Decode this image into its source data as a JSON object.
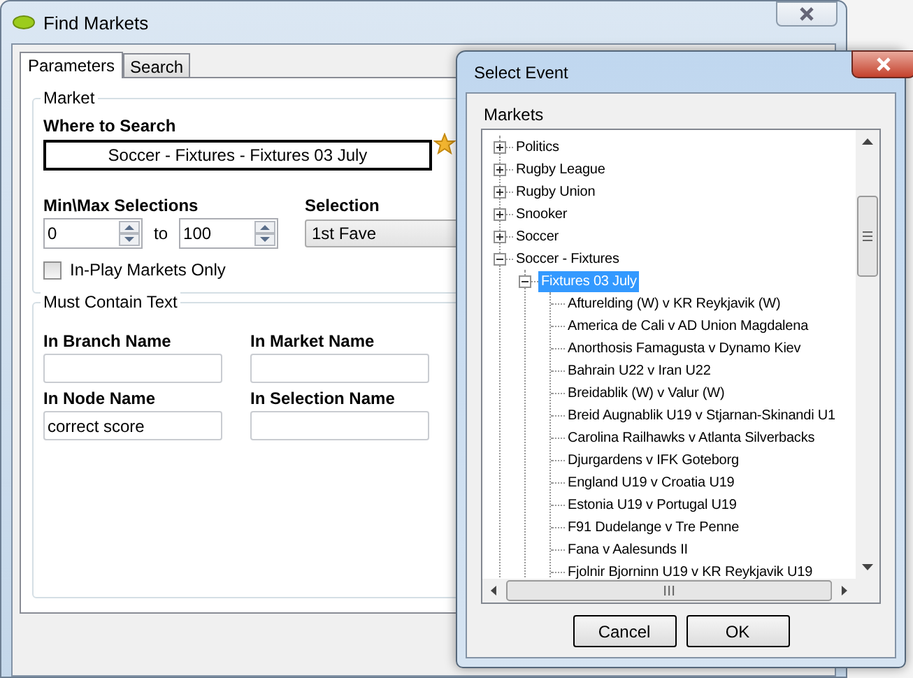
{
  "main_window": {
    "title": "Find Markets",
    "tabs": [
      {
        "label": "Parameters",
        "selected": true
      },
      {
        "label": "Search",
        "selected": false
      }
    ],
    "market_group": {
      "title": "Market",
      "where_label": "Where to Search",
      "where_value": "Soccer - Fixtures - Fixtures 03 July",
      "minmax_label": "Min\\Max Selections",
      "min_value": "0",
      "to_label": "to",
      "max_value": "100",
      "selection_label": "Selection",
      "selection_value": "1st Fave",
      "inplay": {
        "label": "In-Play Markets Only",
        "checked": false
      }
    },
    "text_group": {
      "title": "Must Contain Text",
      "fields": [
        {
          "label": "In Branch Name"
        },
        {
          "label": "In Market Name"
        },
        {
          "label": "In Node Name",
          "value": "correct score"
        },
        {
          "label": "In Selection Name"
        }
      ]
    }
  },
  "dialog": {
    "title": "Select Event",
    "tree_label": "Markets",
    "tree": [
      {
        "label": "Politics",
        "expanded": false,
        "selected": false
      },
      {
        "label": "Rugby League",
        "expanded": false,
        "selected": false
      },
      {
        "label": "Rugby Union",
        "expanded": false,
        "selected": false
      },
      {
        "label": "Snooker",
        "expanded": false,
        "selected": false
      },
      {
        "label": "Soccer",
        "expanded": false,
        "selected": false
      },
      {
        "label": "Soccer - Fixtures",
        "expanded": true,
        "selected": false,
        "children": [
          {
            "label": "Fixtures 03 July",
            "expanded": true,
            "selected": true,
            "children": [
              {
                "label": "Afturelding (W) v KR Reykjavik (W)",
                "selected": false
              },
              {
                "label": "America de Cali v AD Union Magdalena",
                "selected": false
              },
              {
                "label": "Anorthosis Famagusta v Dynamo Kiev",
                "selected": false
              },
              {
                "label": "Bahrain U22 v Iran U22",
                "selected": false
              },
              {
                "label": "Breidablik (W) v Valur (W)",
                "selected": false
              },
              {
                "label": "Breid Augnablik U19 v Stjarnan-Skinandi U1",
                "selected": false
              },
              {
                "label": "Carolina Railhawks v Atlanta Silverbacks",
                "selected": false
              },
              {
                "label": "Djurgardens v IFK Goteborg",
                "selected": false
              },
              {
                "label": "England U19 v Croatia U19",
                "selected": false
              },
              {
                "label": "Estonia U19 v Portugal U19",
                "selected": false
              },
              {
                "label": "F91 Dudelange v Tre Penne",
                "selected": false
              },
              {
                "label": "Fana v Aalesunds II",
                "selected": false
              },
              {
                "label": "Fjolnir Bjorninn U19 v KR Reykjavik U19",
                "selected": false
              }
            ]
          }
        ]
      }
    ],
    "buttons": [
      "Cancel",
      "OK"
    ]
  }
}
